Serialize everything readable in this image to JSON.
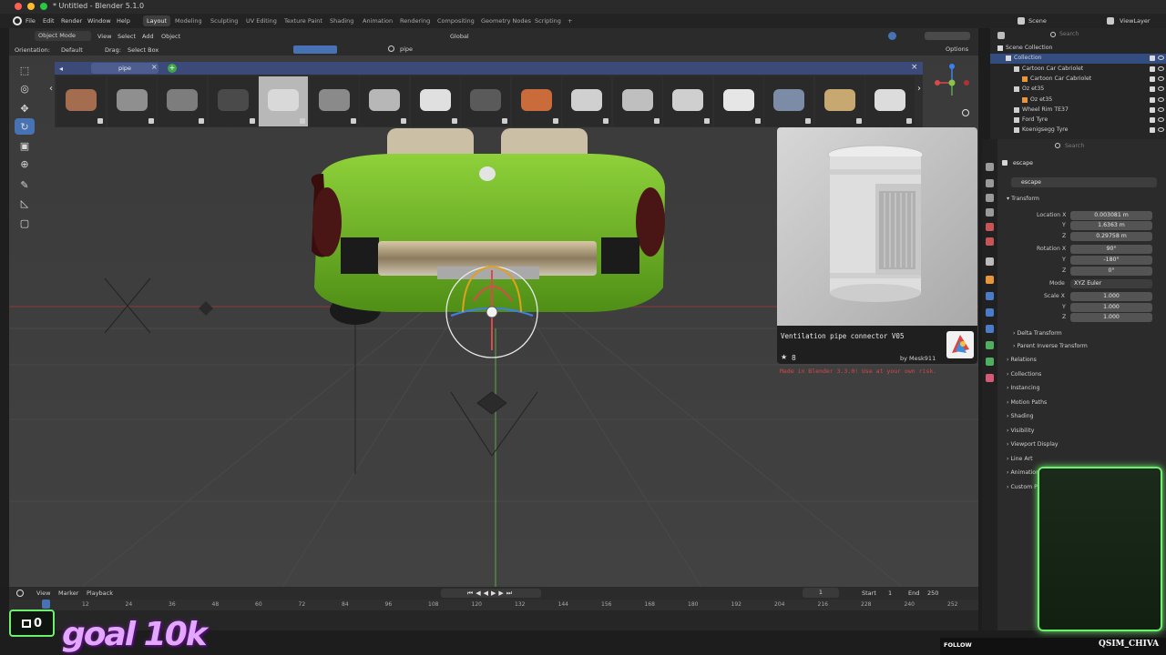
{
  "window": {
    "title": "* Untitled - Blender 5.1.0"
  },
  "menu": [
    "File",
    "Edit",
    "Render",
    "Window",
    "Help"
  ],
  "workspaces": {
    "tabs": [
      "Layout",
      "Modeling",
      "Sculpting",
      "UV Editing",
      "Texture Paint",
      "Shading",
      "Animation",
      "Rendering",
      "Compositing",
      "Geometry Nodes",
      "Scripting"
    ],
    "active": "Layout",
    "add": "+"
  },
  "scene": {
    "name": "Scene",
    "view_layer": "ViewLayer"
  },
  "viewport_header": {
    "mode": "Object Mode",
    "menus": [
      "View",
      "Select",
      "Add",
      "Object"
    ],
    "orientation_label": "Orientation:",
    "orientation_value": "Default",
    "drag_label": "Drag:",
    "drag_value": "Select Box",
    "transform_space": "Global",
    "search_value": "pipe",
    "options_label": "Options"
  },
  "asset_browser": {
    "tab_label": "pipe",
    "thumbs": [
      "brick-pipe",
      "steel-rod",
      "pipe-elbow",
      "dark-elbow",
      "ventilation-pipe",
      "flanged-elbow",
      "valve-pipe",
      "white-cylinder",
      "u-bolt",
      "graffiti-tile",
      "hook-pipe",
      "pipe-tee",
      "pipe-tee-small",
      "drain-cover",
      "faucet",
      "brass-pipe",
      "pipe-connector"
    ]
  },
  "preview": {
    "name": "Ventilation pipe connector V05",
    "rating_count": "8",
    "author": "by Mesk911",
    "warning": "Made in Blender 3.3.0! Use at your own risk."
  },
  "outliner": {
    "search_placeholder": "Search",
    "rows": [
      {
        "label": "Scene Collection",
        "indent": 0,
        "selected": false
      },
      {
        "label": "Collection",
        "indent": 1,
        "selected": true
      },
      {
        "label": "Cartoon Car Cabriolet",
        "indent": 2,
        "selected": false
      },
      {
        "label": "Cartoon Car Cabriolet",
        "indent": 3,
        "selected": false
      },
      {
        "label": "Oz et35",
        "indent": 2,
        "selected": false
      },
      {
        "label": "Oz et35",
        "indent": 3,
        "selected": false
      },
      {
        "label": "Wheel Rim TE37",
        "indent": 2,
        "selected": false
      },
      {
        "label": "Ford Tyre",
        "indent": 2,
        "selected": false
      },
      {
        "label": "Koenigsegg Tyre",
        "indent": 2,
        "selected": false
      }
    ]
  },
  "properties": {
    "search_placeholder": "Search",
    "object_name": "escape",
    "object_field": "escape",
    "transform_title": "Transform",
    "location_label": "Location X",
    "location": [
      "0.003081 m",
      "1.6363 m",
      "0.29758 m"
    ],
    "rotation_label": "Rotation X",
    "rotation": [
      "90°",
      "-180°",
      "0°"
    ],
    "mode_label": "Mode",
    "mode_value": "XYZ Euler",
    "scale_label": "Scale X",
    "scale": [
      "1.000",
      "1.000",
      "1.000"
    ],
    "axis_y": "Y",
    "axis_z": "Z",
    "sub_sections": [
      "Delta Transform",
      "Parent Inverse Transform"
    ],
    "sections": [
      "Relations",
      "Collections",
      "Instancing",
      "Motion Paths",
      "Shading",
      "Visibility",
      "Viewport Display",
      "Line Art",
      "Animation",
      "Custom Properties"
    ]
  },
  "timeline": {
    "menus": [
      "View",
      "Marker",
      "Playback"
    ],
    "current_frame": "1",
    "start_label": "Start",
    "start_value": "1",
    "end_label": "End",
    "end_value": "250",
    "ticks": [
      "12",
      "24",
      "36",
      "48",
      "60",
      "72",
      "84",
      "96",
      "108",
      "120",
      "132",
      "144",
      "156",
      "168",
      "180",
      "192",
      "204",
      "216",
      "228",
      "240",
      "252"
    ]
  },
  "overlay": {
    "goal_count": "0",
    "goal_text": "goal 10k",
    "follow_label": "FOLLOW",
    "channel": "QSIM_CHIVA"
  },
  "colors": {
    "accent": "#4772b3",
    "car_body": "#6fb72a",
    "webcam_border": "#6df06d",
    "goal_text": "#e4a7ff"
  }
}
